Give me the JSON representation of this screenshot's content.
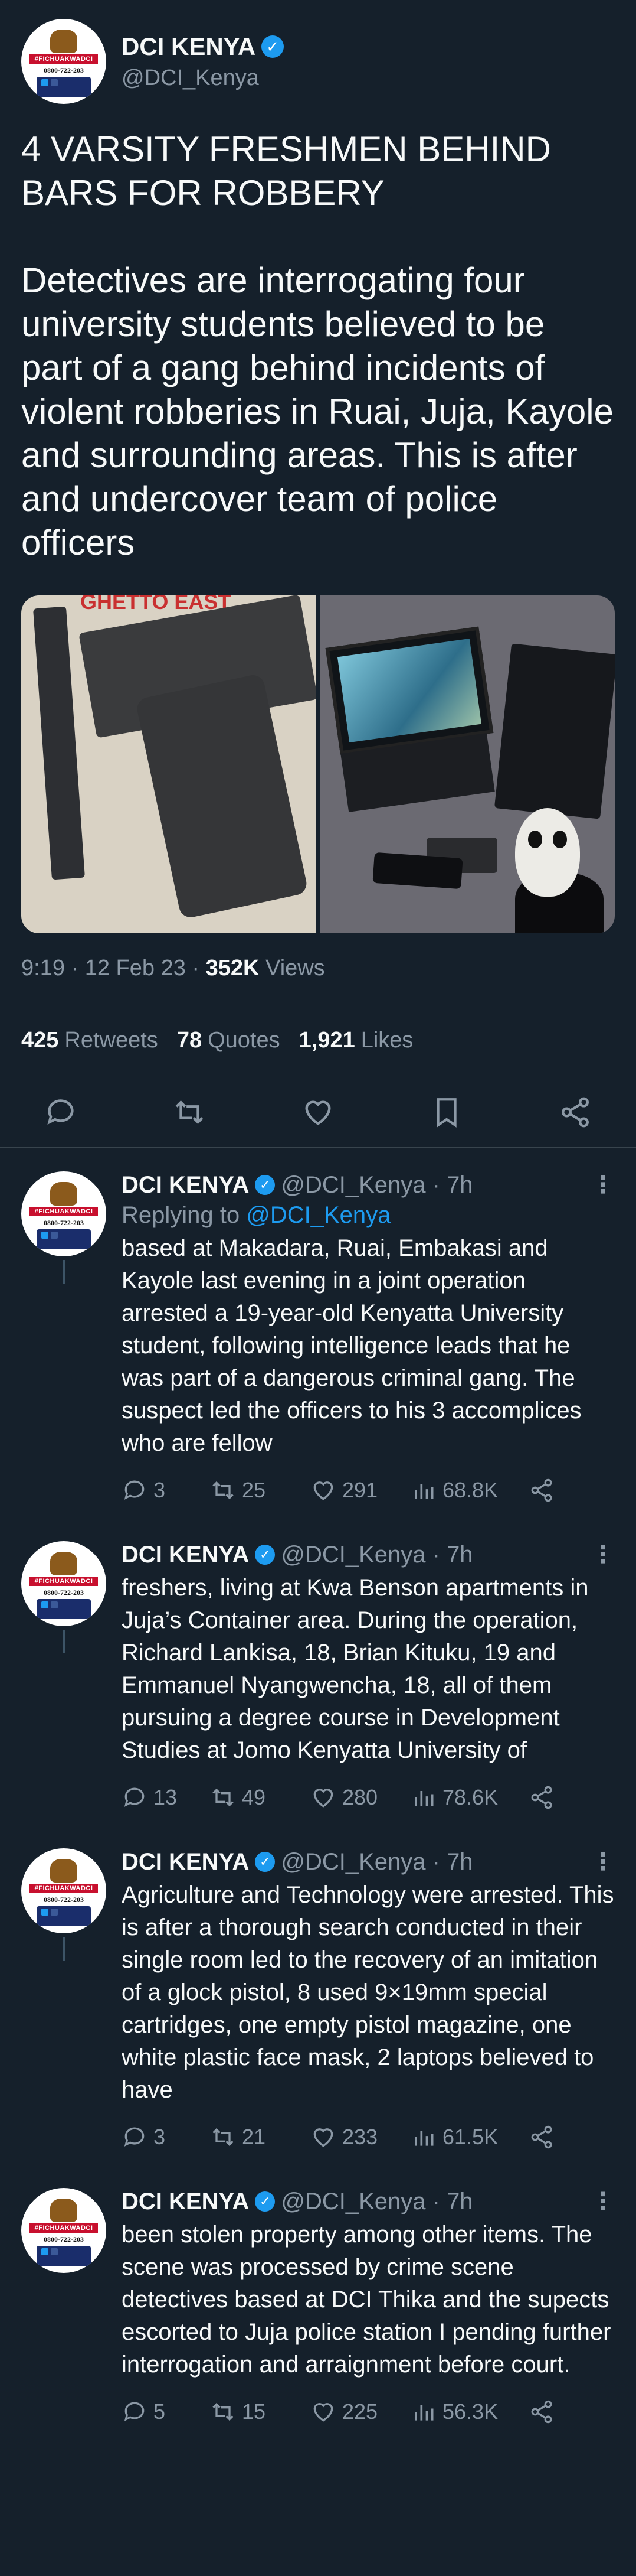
{
  "author": {
    "display_name": "DCI KENYA",
    "handle": "@DCI_Kenya",
    "avatar_tag": "#FICHUAKWADCI",
    "avatar_phone": "0800-722-203"
  },
  "tweet": {
    "text": "4 VARSITY FRESHMEN BEHIND BARS FOR ROBBERY\n\nDetectives are interrogating four university students believed to be part of a gang behind incidents of violent robberies in Ruai, Juja, Kayole and surrounding areas. This is after and undercover team of police officers",
    "image_overlay_text": "GHETTO EAST",
    "time": "9:19 · 12 Feb 23 · ",
    "views_count": "352K",
    "views_label": " Views"
  },
  "stats": {
    "retweets_count": "425",
    "retweets_label": "Retweets",
    "quotes_count": "78",
    "quotes_label": "Quotes",
    "likes_count": "1,921",
    "likes_label": "Likes"
  },
  "replies": [
    {
      "name": "DCI KENYA",
      "handle_time": "@DCI_Kenya · 7h",
      "replying_prefix": "Replying to ",
      "replying_mention": "@DCI_Kenya",
      "text": "based at Makadara, Ruai, Embakasi and Kayole last evening in a joint operation arrested a 19-year-old Kenyatta University student, following intelligence leads that he was part of a dangerous criminal gang. The suspect led the officers to his 3 accomplices who are fellow",
      "reply_count": "3",
      "retweet_count": "25",
      "like_count": "291",
      "view_count": "68.8K"
    },
    {
      "name": "DCI KENYA",
      "handle_time": "@DCI_Kenya · 7h",
      "text": "freshers, living at Kwa Benson apartments in Juja’s Container area. During the operation, Richard Lankisa, 18, Brian Kituku, 19 and Emmanuel Nyangwencha, 18, all of them pursuing a degree course in Development Studies at Jomo Kenyatta University of",
      "reply_count": "13",
      "retweet_count": "49",
      "like_count": "280",
      "view_count": "78.6K"
    },
    {
      "name": "DCI KENYA",
      "handle_time": "@DCI_Kenya · 7h",
      "text": "Agriculture and Technology were arrested. This is after a thorough search conducted in their single room led to the recovery of an imitation of a glock pistol, 8 used 9×19mm special cartridges, one empty pistol magazine, one white plastic face mask, 2 laptops believed to have",
      "reply_count": "3",
      "retweet_count": "21",
      "like_count": "233",
      "view_count": "61.5K"
    },
    {
      "name": "DCI KENYA",
      "handle_time": "@DCI_Kenya · 7h",
      "text": "been stolen property among other items. The scene was processed by crime scene detectives based at DCI Thika and the supects escorted to Juja police station I pending further interrogation and arraignment before court.",
      "reply_count": "5",
      "retweet_count": "15",
      "like_count": "225",
      "view_count": "56.3K"
    }
  ],
  "colors": {
    "background": "#15202b",
    "text": "#f7f9f9",
    "muted": "#8b98a5",
    "accent": "#1d9bf0",
    "divider": "#38444d"
  },
  "icons": [
    "verified-badge-icon",
    "reply-icon",
    "retweet-icon",
    "like-icon",
    "bookmark-icon",
    "share-icon",
    "views-icon",
    "more-icon"
  ]
}
